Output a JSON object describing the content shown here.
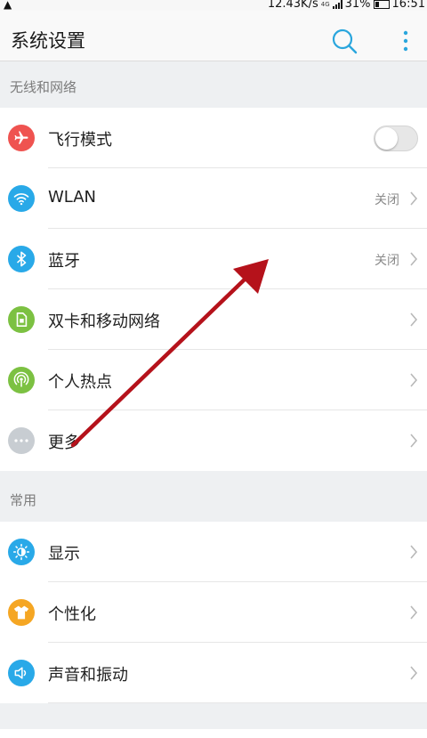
{
  "status_bar": {
    "alert_icon": "warning-triangle",
    "speed": "12.43K/s",
    "network_type": "4G",
    "battery": "31%",
    "time": "16:51"
  },
  "app_bar": {
    "title": "系统设置",
    "actions": [
      "search-icon",
      "more-vert-icon"
    ]
  },
  "sections": [
    {
      "header": "无线和网络",
      "items": [
        {
          "label": "飞行模式",
          "icon": "airplane-icon",
          "color": "#ef5350",
          "toggle": "off"
        },
        {
          "label": "WLAN",
          "icon": "wifi-icon",
          "color": "#29a9e8",
          "status": "关闭"
        },
        {
          "label": "蓝牙",
          "icon": "bluetooth-icon",
          "color": "#29a9e8",
          "status": "关闭"
        },
        {
          "label": "双卡和移动网络",
          "icon": "sim-card-icon",
          "color": "#7cc142"
        },
        {
          "label": "个人热点",
          "icon": "hotspot-icon",
          "color": "#7cc142"
        },
        {
          "label": "更多",
          "icon": "more-dots-icon",
          "color": "#c8cdd2"
        }
      ]
    },
    {
      "header": "常用",
      "items": [
        {
          "label": "显示",
          "icon": "brightness-icon",
          "color": "#29a9e8"
        },
        {
          "label": "个性化",
          "icon": "shirt-icon",
          "color": "#f5a623"
        },
        {
          "label": "声音和振动",
          "icon": "speaker-icon",
          "color": "#29a9e8"
        }
      ]
    }
  ],
  "overlay": {
    "annotation": "red-arrow",
    "color": "#b5121b"
  }
}
